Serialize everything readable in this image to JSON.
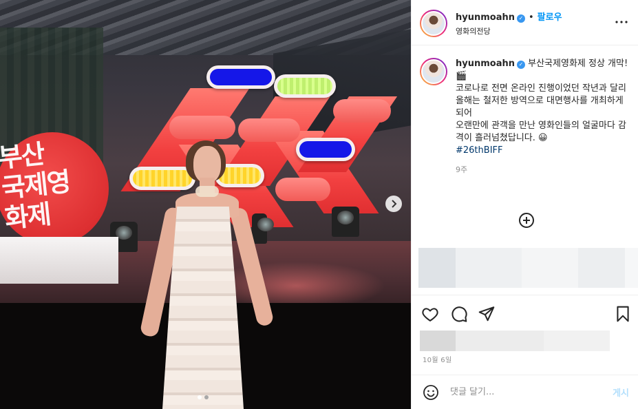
{
  "post": {
    "username": "hyunmoahn",
    "follow_label": "팔로우",
    "separator": "•",
    "location": "영화의전당",
    "more_label": "•••",
    "caption_user": "hyunmoahn",
    "caption_lines": [
      "부산국제영화제 정상 개막! 🎬",
      "코로나로 전면 온라인 진행이었던 작년과 달리",
      "올해는 철저한 방역으로 대면행사를 개최하게 되어",
      "오랜만에 관객을 만난 영화인들의 얼굴마다 감격이 흘러넘쳤답니다. 😀"
    ],
    "hashtag": "#26thBIFF",
    "time_ago": "9주",
    "date": "10월 6일"
  },
  "photo": {
    "sign_text": "부산\n국제영\n화제",
    "carousel": {
      "count": 2,
      "active_index": 0
    }
  },
  "comment": {
    "placeholder": "댓글 달기...",
    "post_label": "게시"
  },
  "icons": {
    "verified": "verified-badge-icon",
    "more": "more-options-icon",
    "like": "heart-icon",
    "comment": "comment-bubble-icon",
    "share": "paper-plane-icon",
    "save": "bookmark-icon",
    "add": "plus-circle-icon",
    "emoji": "smiley-icon",
    "next": "chevron-right-icon"
  },
  "colors": {
    "accent": "#0095f6",
    "verified": "#3897f0",
    "post_disabled": "#b2dffc",
    "hashtag": "#00376b",
    "muted": "#8e8e8e",
    "biff_red": "#f24040"
  }
}
